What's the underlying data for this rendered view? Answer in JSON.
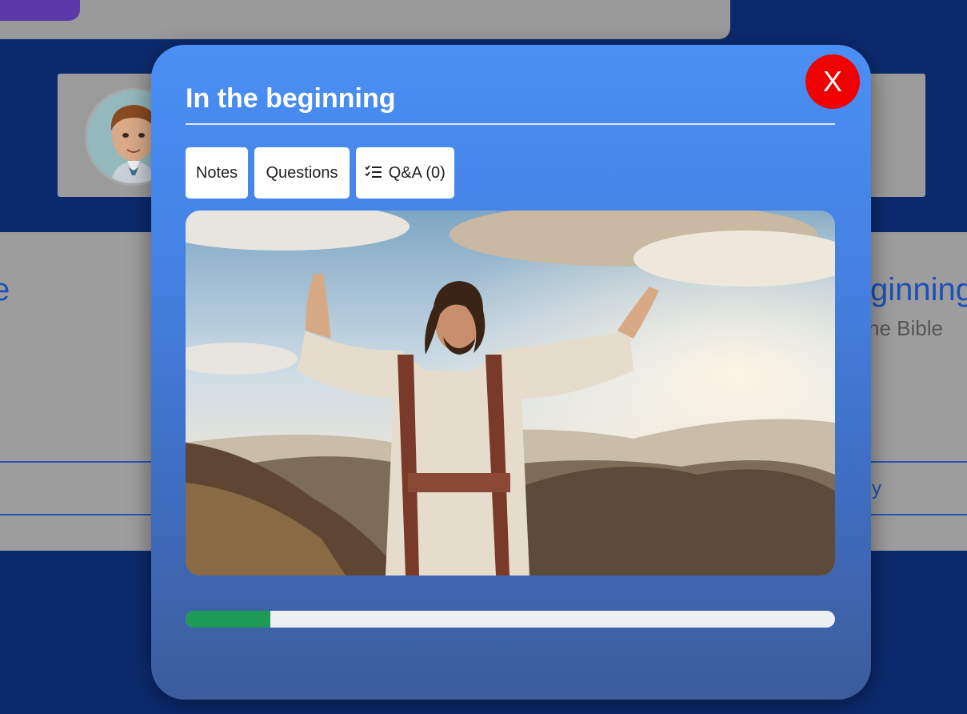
{
  "modal": {
    "title": "In the beginning",
    "close_label": "X",
    "tabs": {
      "notes": "Notes",
      "questions": "Questions",
      "qa": "Q&A (0)"
    },
    "progress_percent": 13,
    "colors": {
      "close_button": "#f00000",
      "progress_fill": "#1d9a55",
      "progress_track": "#edeff2",
      "modal_top": "#4a8ff5",
      "modal_bottom": "#3c5c9a"
    }
  },
  "background": {
    "left_card_heading_fragment": "e",
    "right_card_heading_fragment": "ginning",
    "right_card_subtitle_fragment": "he Bible",
    "right_card_link_fragment": "y"
  }
}
